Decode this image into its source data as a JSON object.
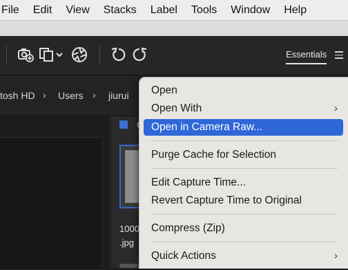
{
  "menubar": {
    "items": [
      "File",
      "Edit",
      "View",
      "Stacks",
      "Label",
      "Tools",
      "Window",
      "Help"
    ]
  },
  "toolbar": {
    "icons": [
      "camera-add-icon",
      "copy-stack-icon",
      "aperture-icon",
      "rotate-left-icon",
      "rotate-right-icon"
    ],
    "workspace_label": "Essentials"
  },
  "path": {
    "crumbs": [
      "tosh HD",
      "Users",
      "jiurui"
    ]
  },
  "content": {
    "card_label": "C",
    "file_name_line1": "1000",
    "file_name_line2": ".jpg"
  },
  "context_menu": {
    "items": [
      {
        "label": "Open",
        "submenu": false,
        "highlighted": false
      },
      {
        "label": "Open With",
        "submenu": true,
        "highlighted": false
      },
      {
        "label": "Open in Camera Raw...",
        "submenu": false,
        "highlighted": true
      },
      {
        "label": "Purge Cache for Selection",
        "submenu": false,
        "highlighted": false
      },
      {
        "label": "Edit Capture Time...",
        "submenu": false,
        "highlighted": false
      },
      {
        "label": "Revert Capture Time to Original",
        "submenu": false,
        "highlighted": false
      },
      {
        "label": "Compress (Zip)",
        "submenu": false,
        "highlighted": false
      },
      {
        "label": "Quick Actions",
        "submenu": true,
        "highlighted": false
      }
    ],
    "submenu_arrow": "›"
  },
  "colors": {
    "highlight": "#2f67d8",
    "selection_border": "#3c64c4",
    "app_background": "#1e1e1e",
    "menu_background": "#e8e6e3"
  }
}
